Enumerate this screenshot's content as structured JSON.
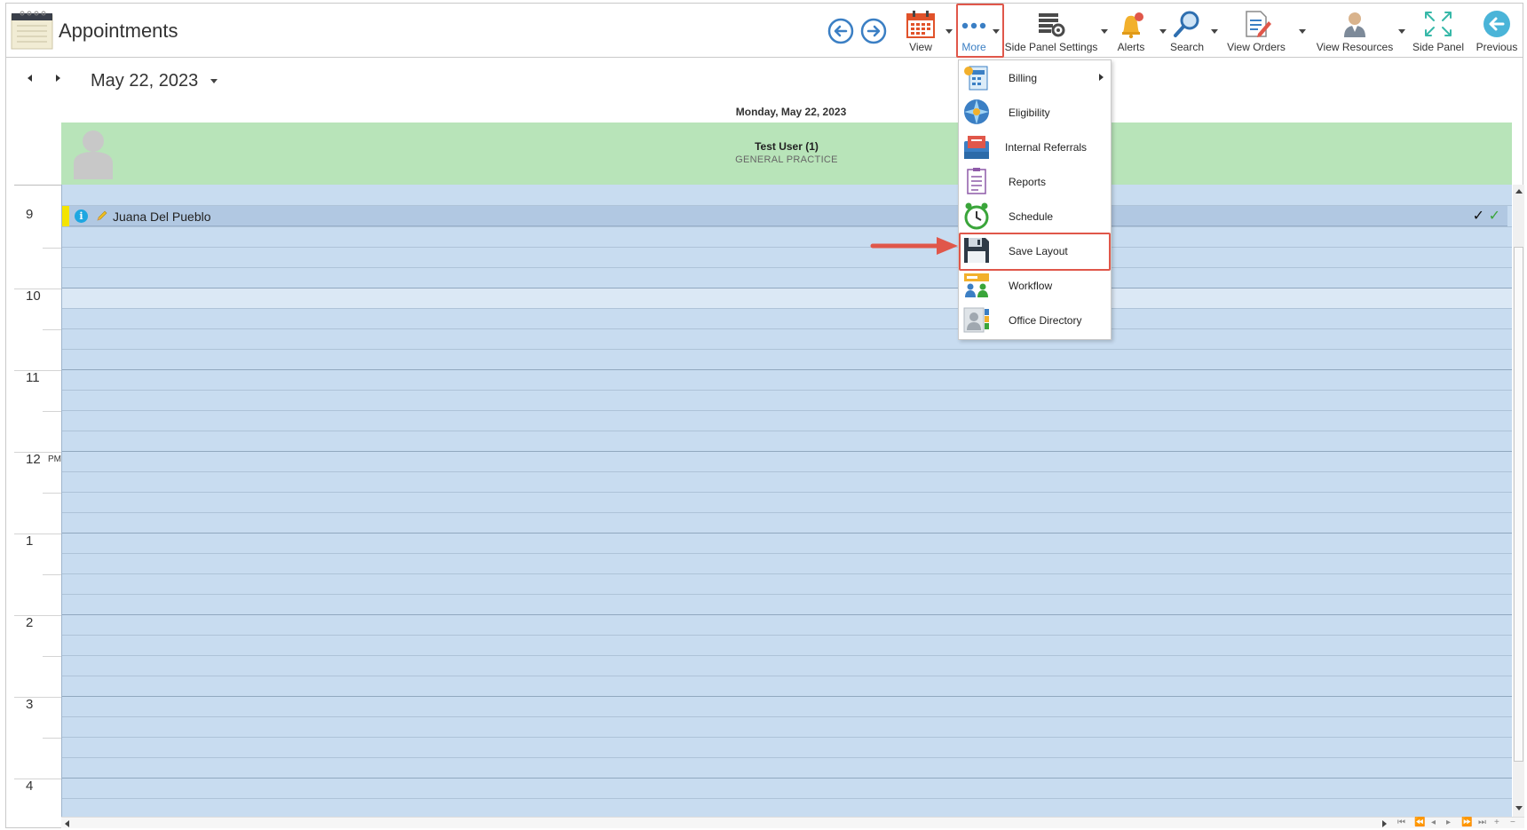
{
  "header": {
    "title": "Appointments"
  },
  "toolbar": {
    "view_label": "View",
    "more_label": "More",
    "side_panel_settings_label": "Side Panel Settings",
    "alerts_label": "Alerts",
    "search_label": "Search",
    "view_orders_label": "View Orders",
    "view_resources_label": "View Resources",
    "side_panel_label": "Side Panel",
    "previous_label": "Previous"
  },
  "calendar": {
    "date": "May 22, 2023",
    "day_header": "Monday, May 22, 2023",
    "hours": [
      "9",
      "10",
      "11",
      "12",
      "1",
      "2",
      "3",
      "4"
    ],
    "pm_label": "PM"
  },
  "resource": {
    "name": "Test User (1)",
    "specialty": "GENERAL PRACTICE"
  },
  "appointment": {
    "info_glyph": "i",
    "patient_name": "Juana Del Pueblo",
    "status_color": "#f4e400"
  },
  "more_menu": {
    "items": [
      {
        "label": "Billing",
        "icon": "billing-icon",
        "has_submenu": true
      },
      {
        "label": "Eligibility",
        "icon": "eligibility-icon"
      },
      {
        "label": "Internal Referrals",
        "icon": "internal-referrals-icon"
      },
      {
        "label": "Reports",
        "icon": "reports-icon"
      },
      {
        "label": "Schedule",
        "icon": "schedule-clock-icon"
      },
      {
        "label": "Save Layout",
        "icon": "floppy-disk-icon",
        "highlighted": true
      },
      {
        "label": "Workflow",
        "icon": "workflow-icon"
      },
      {
        "label": "Office Directory",
        "icon": "office-directory-icon"
      }
    ]
  },
  "colors": {
    "highlight": "#e0574a",
    "grid": "#c8dcf0",
    "resource_header": "#b8e4b9",
    "appointment": "#b1c8e2"
  }
}
